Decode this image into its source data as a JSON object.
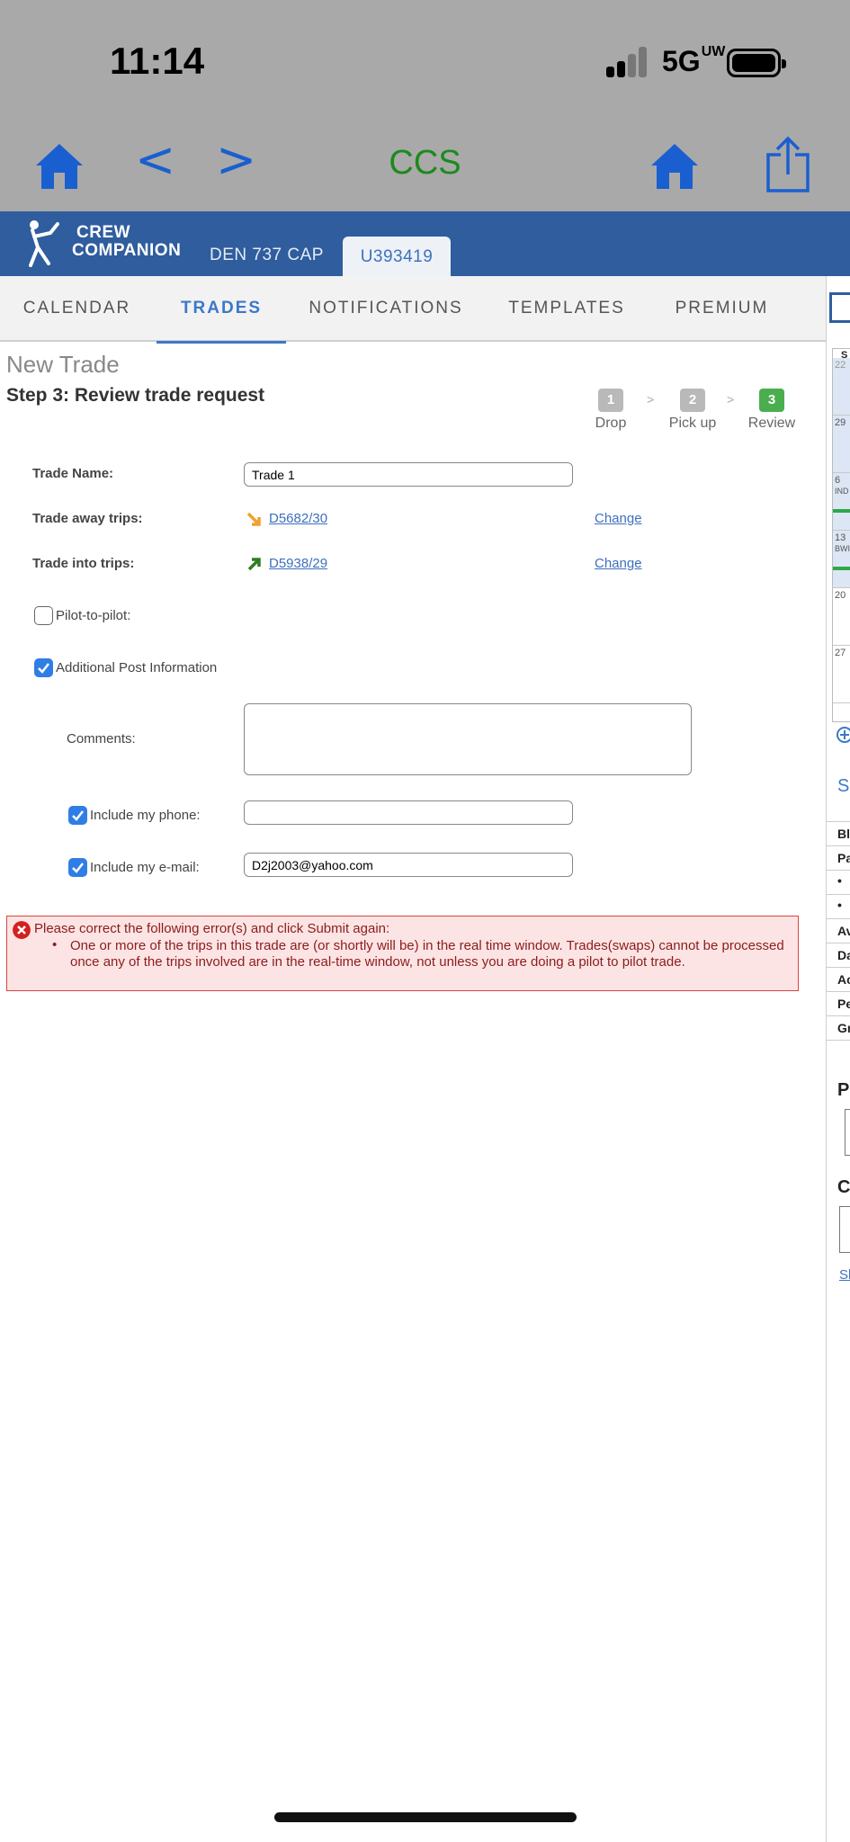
{
  "status_bar": {
    "time": "11:14",
    "network": "5G",
    "network_suffix": "UW"
  },
  "browser": {
    "title": "CCS"
  },
  "app": {
    "logo_line1": "CREW",
    "logo_line2": "COMPANION",
    "base": "DEN 737 CAP",
    "user_id": "U393419"
  },
  "nav": {
    "tabs": [
      "CALENDAR",
      "TRADES",
      "NOTIFICATIONS",
      "TEMPLATES",
      "PREMIUM"
    ],
    "active": "TRADES"
  },
  "page": {
    "title": "New Trade",
    "step_title": "Step 3: Review trade request",
    "steps": [
      {
        "num": "1",
        "label": "Drop"
      },
      {
        "num": "2",
        "label": "Pick up"
      },
      {
        "num": "3",
        "label": "Review"
      }
    ],
    "step_sep": ">"
  },
  "form": {
    "trade_name_label": "Trade Name:",
    "trade_name_value": "Trade 1",
    "trade_away_label": "Trade away trips:",
    "trade_away_trip": "D5682/30",
    "trade_into_label": "Trade into trips:",
    "trade_into_trip": "D5938/29",
    "change_label": "Change",
    "pilot_to_pilot_label": "Pilot-to-pilot:",
    "pilot_to_pilot_checked": false,
    "additional_info_label": "Additional Post Information",
    "additional_info_checked": true,
    "comments_label": "Comments:",
    "comments_value": "",
    "include_phone_label": "Include my phone:",
    "include_phone_checked": true,
    "phone_value": "",
    "include_email_label": "Include my e-mail:",
    "include_email_checked": true,
    "email_value": "D2j2003@yahoo.com"
  },
  "error": {
    "heading": "Please correct the following error(s) and click Submit again:",
    "messages": [
      "One or more of the trips in this trade are (or shortly will be) in the real time window. Trades(swaps) cannot be processed once any of the trips involved are in the real-time window, not unless you are doing a pilot to pilot trade."
    ]
  },
  "side_panel": {
    "calendar_days": [
      "22",
      "29",
      "6",
      "13",
      "20",
      "27"
    ],
    "row_tags": [
      "",
      "",
      "IND",
      "BWI",
      "",
      ""
    ],
    "section_letter": "SU",
    "labels": [
      "Bl",
      "Pa",
      "•",
      "•",
      "Av",
      "Da",
      "Ac",
      "Pe",
      "Gr"
    ],
    "heading_p": "P",
    "heading_c": "C",
    "link_fragment": "Sh",
    "top_fragment": "S",
    "colors": {
      "accent": "#2f5d9e",
      "active_tab": "#3b78c9",
      "error_bg": "#fde4e4",
      "success": "#4aae4f"
    }
  }
}
